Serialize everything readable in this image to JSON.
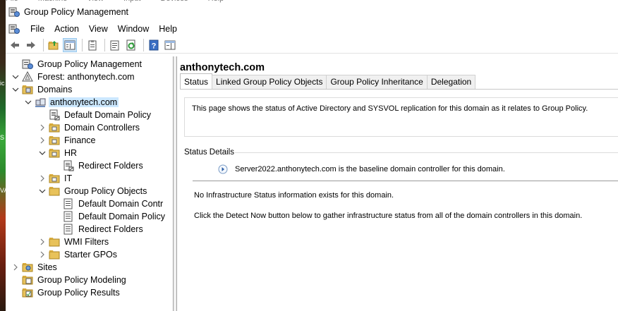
{
  "vm_menu": [
    "File",
    "Machine",
    "View",
    "Input",
    "Devices",
    "Help"
  ],
  "desktop_strip": [
    "ic",
    "S",
    "VA"
  ],
  "window": {
    "title": "Group Policy Management"
  },
  "menubar": [
    "File",
    "Action",
    "View",
    "Window",
    "Help"
  ],
  "toolbar": [
    {
      "name": "back-icon"
    },
    {
      "name": "forward-icon"
    },
    {
      "name": "up-folder-icon"
    },
    {
      "name": "show-hide-tree-icon",
      "active": true
    },
    {
      "name": "clipboard-icon"
    },
    {
      "name": "properties-icon"
    },
    {
      "name": "refresh-icon"
    },
    {
      "name": "help-icon"
    },
    {
      "name": "show-action-pane-icon"
    }
  ],
  "tree": [
    {
      "label": "Group Policy Management",
      "level": 0,
      "expander": "none",
      "icon": "gpm-icon"
    },
    {
      "label": "Forest: anthonytech.com",
      "level": 0,
      "expander": "expanded",
      "icon": "forest-icon"
    },
    {
      "label": "Domains",
      "level": 1,
      "expander": "expanded",
      "icon": "domains-icon"
    },
    {
      "label": "anthonytech.com",
      "level": 2,
      "expander": "expanded",
      "icon": "domain-icon",
      "selected": true
    },
    {
      "label": "Default Domain Policy",
      "level": 3,
      "expander": "none",
      "icon": "gpo-link-icon"
    },
    {
      "label": "Domain Controllers",
      "level": 3,
      "expander": "collapsed",
      "icon": "ou-icon"
    },
    {
      "label": "Finance",
      "level": 3,
      "expander": "collapsed",
      "icon": "ou-icon"
    },
    {
      "label": "HR",
      "level": 3,
      "expander": "expanded",
      "icon": "ou-icon"
    },
    {
      "label": "Redirect Folders",
      "level": 4,
      "expander": "none",
      "icon": "gpo-link-icon"
    },
    {
      "label": "IT",
      "level": 3,
      "expander": "collapsed",
      "icon": "ou-icon"
    },
    {
      "label": "Group Policy Objects",
      "level": 3,
      "expander": "expanded",
      "icon": "folder-icon"
    },
    {
      "label": "Default Domain Contr",
      "level": 4,
      "expander": "none",
      "icon": "gpo-icon"
    },
    {
      "label": "Default Domain Policy",
      "level": 4,
      "expander": "none",
      "icon": "gpo-icon"
    },
    {
      "label": "Redirect Folders",
      "level": 4,
      "expander": "none",
      "icon": "gpo-icon"
    },
    {
      "label": "WMI Filters",
      "level": 3,
      "expander": "collapsed",
      "icon": "folder-icon"
    },
    {
      "label": "Starter GPOs",
      "level": 3,
      "expander": "collapsed",
      "icon": "folder-icon"
    },
    {
      "label": "Sites",
      "level": 1,
      "expander": "collapsed",
      "icon": "sites-icon"
    },
    {
      "label": "Group Policy Modeling",
      "level": 1,
      "expander": "none",
      "icon": "modeling-icon"
    },
    {
      "label": "Group Policy Results",
      "level": 1,
      "expander": "none",
      "icon": "results-icon"
    }
  ],
  "content": {
    "heading": "anthonytech.com",
    "tabs": [
      {
        "label": "Status",
        "active": true
      },
      {
        "label": "Linked Group Policy Objects",
        "active": false
      },
      {
        "label": "Group Policy Inheritance",
        "active": false
      },
      {
        "label": "Delegation",
        "active": false
      }
    ],
    "description": "This page shows the status of Active Directory and SYSVOL replication for this domain as it relates to Group Policy.",
    "status_details_label": "Status Details",
    "baseline_dc": "Server2022.anthonytech.com is the baseline domain controller for this domain.",
    "no_infra_msg": "No Infrastructure Status information exists for this domain.",
    "detect_msg": "Click the Detect Now button below to gather infrastructure status from all of the domain controllers in this domain."
  }
}
